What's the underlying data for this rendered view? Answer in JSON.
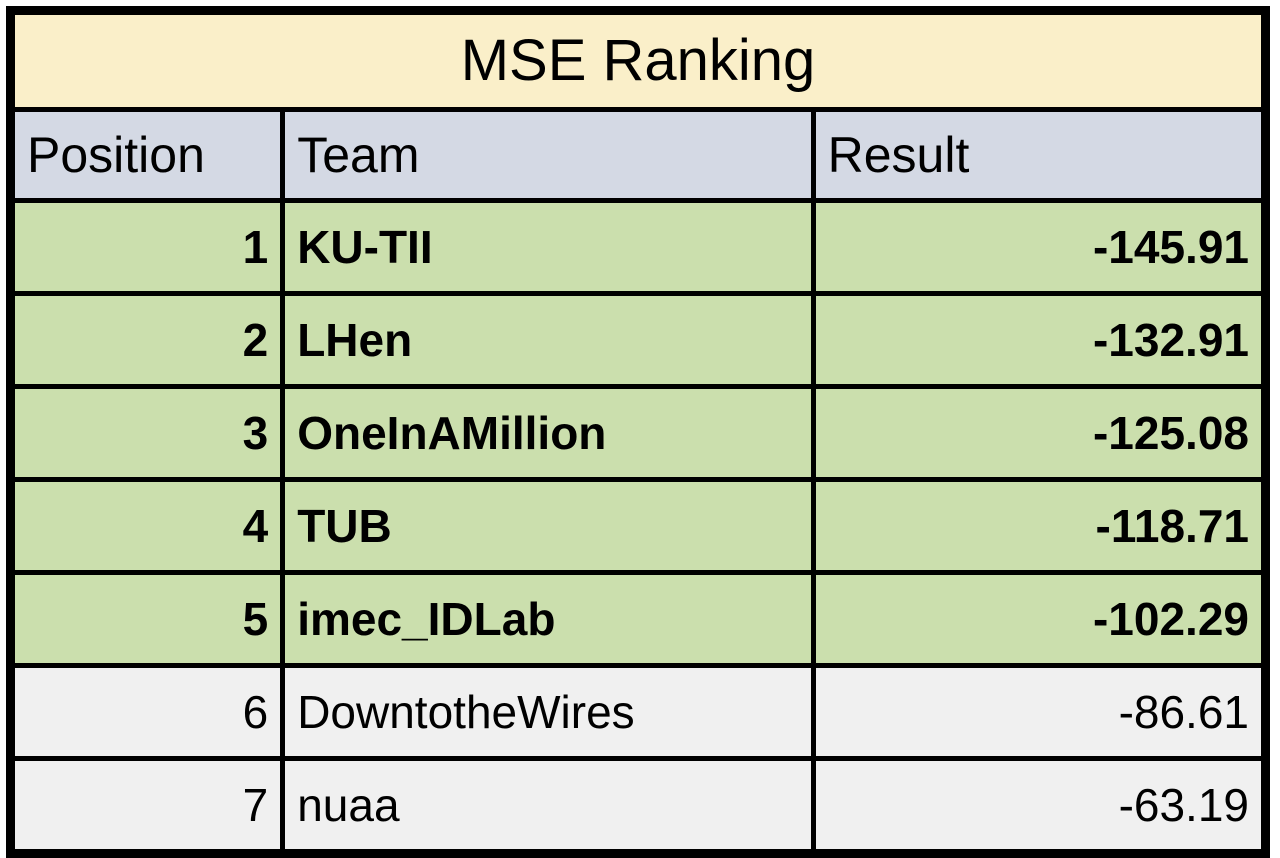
{
  "table": {
    "title": "MSE Ranking",
    "columns": [
      {
        "key": "position",
        "label": "Position"
      },
      {
        "key": "team",
        "label": "Team"
      },
      {
        "key": "result",
        "label": "Result"
      }
    ],
    "rows": [
      {
        "position": "1",
        "team": "KU-TII",
        "result": "-145.91",
        "highlighted": true
      },
      {
        "position": "2",
        "team": "LHen",
        "result": "-132.91",
        "highlighted": true
      },
      {
        "position": "3",
        "team": "OneInAMillion",
        "result": "-125.08",
        "highlighted": true
      },
      {
        "position": "4",
        "team": "TUB",
        "result": "-118.71",
        "highlighted": true
      },
      {
        "position": "5",
        "team": "imec_IDLab",
        "result": "-102.29",
        "highlighted": true
      },
      {
        "position": "6",
        "team": "DowntotheWires",
        "result": "-86.61",
        "highlighted": false
      },
      {
        "position": "7",
        "team": "nuaa",
        "result": "-63.19",
        "highlighted": false
      }
    ],
    "colors": {
      "title_background": "#faefc9",
      "header_background": "#d4d9e4",
      "highlight_row_background": "#cbdfad",
      "plain_row_background": "#f0f0f0",
      "border": "#000000",
      "text": "#000000"
    }
  },
  "chart_data": {
    "type": "table",
    "title": "MSE Ranking",
    "columns": [
      "Position",
      "Team",
      "Result"
    ],
    "categories": [
      "KU-TII",
      "LHen",
      "OneInAMillion",
      "TUB",
      "imec_IDLab",
      "DowntotheWires",
      "nuaa"
    ],
    "values": [
      -145.91,
      -132.91,
      -125.08,
      -118.71,
      -102.29,
      -86.61,
      -63.19
    ],
    "xlabel": "Team",
    "ylabel": "Result",
    "rows": [
      [
        "1",
        "KU-TII",
        "-145.91"
      ],
      [
        "2",
        "LHen",
        "-132.91"
      ],
      [
        "3",
        "OneInAMillion",
        "-125.08"
      ],
      [
        "4",
        "TUB",
        "-118.71"
      ],
      [
        "5",
        "imec_IDLab",
        "-102.29"
      ],
      [
        "6",
        "DowntotheWires",
        "-86.61"
      ],
      [
        "7",
        "nuaa",
        "-63.19"
      ]
    ]
  }
}
